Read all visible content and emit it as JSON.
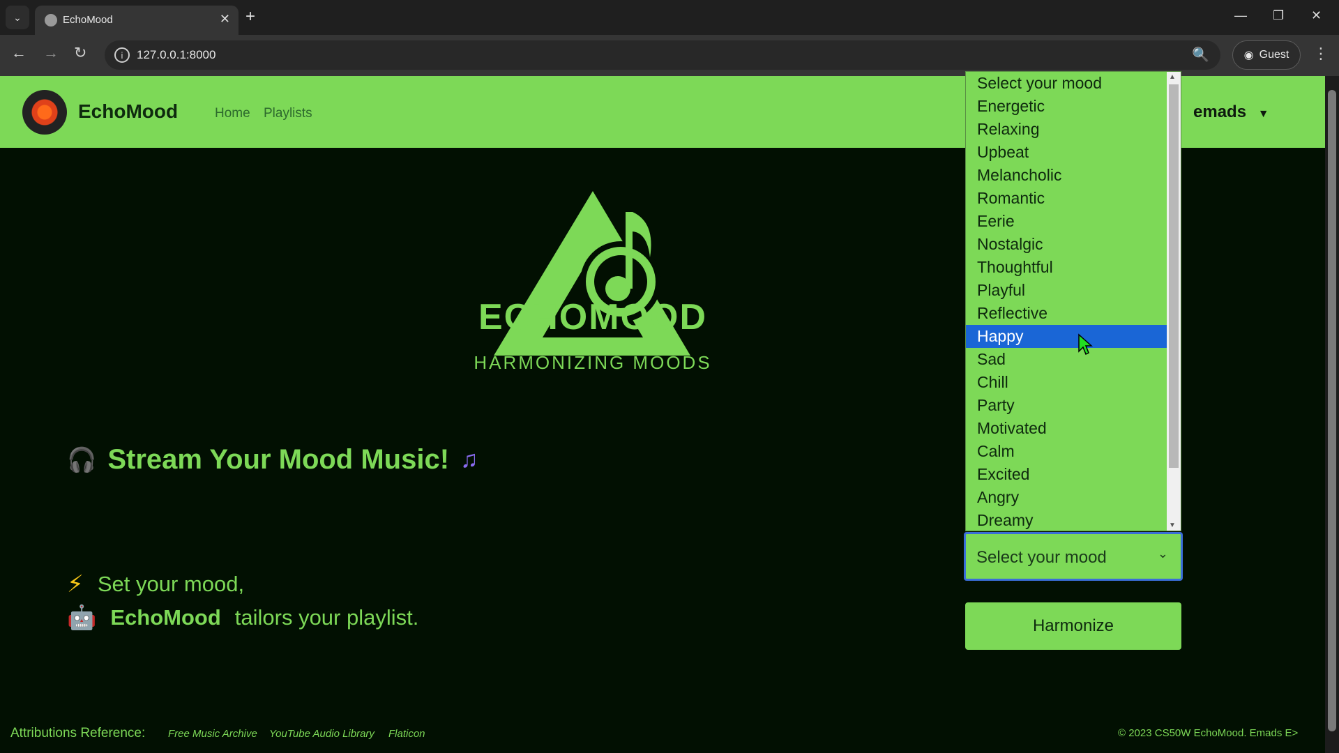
{
  "browser": {
    "tab_title": "EchoMood",
    "url": "127.0.0.1:8000",
    "profile_label": "Guest"
  },
  "navbar": {
    "brand": "EchoMood",
    "links": [
      "Home",
      "Playlists"
    ],
    "user": "emads"
  },
  "hero": {
    "wordmark": "ECHOMOOD",
    "tagline": "HARMONIZING MOODS"
  },
  "intro": {
    "title": "Stream Your Mood Music!",
    "line1": "Set your mood,",
    "line2_brand": "EchoMood",
    "line2_rest": "tailors your playlist."
  },
  "mood_select": {
    "value": "Select your mood",
    "options": [
      "Select your mood",
      "Energetic",
      "Relaxing",
      "Upbeat",
      "Melancholic",
      "Romantic",
      "Eerie",
      "Nostalgic",
      "Thoughtful",
      "Playful",
      "Reflective",
      "Happy",
      "Sad",
      "Chill",
      "Party",
      "Motivated",
      "Calm",
      "Excited",
      "Angry",
      "Dreamy"
    ],
    "highlighted": "Happy"
  },
  "harmonize_label": "Harmonize",
  "footer": {
    "attributions_label": "Attributions Reference:",
    "links": [
      "Free Music Archive",
      "YouTube Audio Library",
      "Flaticon"
    ],
    "copyright": "© 2023 CS50W EchoMood. Emads E>"
  },
  "colors": {
    "accent": "#7dd957",
    "background": "#021002",
    "highlight": "#1a66d6"
  }
}
